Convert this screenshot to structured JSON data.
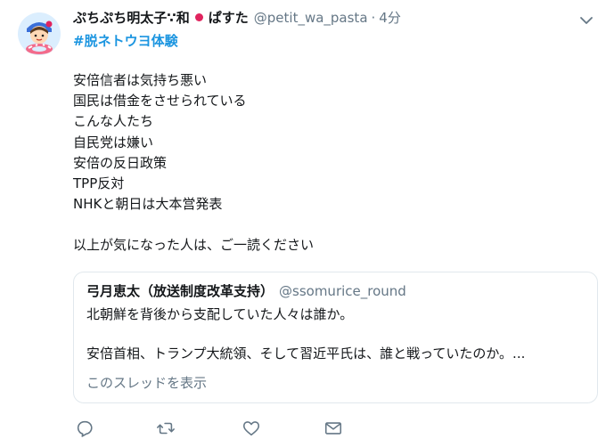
{
  "author": {
    "display_name_part1": "ぷちぷち明太子∵和",
    "display_name_part2": "ぱすた",
    "handle": "@petit_wa_pasta",
    "separator": "·",
    "time": "4分"
  },
  "hashtag": "#脱ネトウヨ体験",
  "tweet_lines": [
    "安倍信者は気持ち悪い",
    "国民は借金をさせられている",
    "こんな人たち",
    "自民党は嫌い",
    "安倍の反日政策",
    "TPP反対",
    "NHKと朝日は大本営発表",
    "",
    "以上が気になった人は、ご一読ください"
  ],
  "quoted": {
    "name": "弓月恵太（放送制度改革支持）",
    "handle": "@ssomurice_round",
    "line1": "北朝鮮を背後から支配していた人々は誰か。",
    "line2": "安倍首相、トランプ大統領、そして習近平氏は、誰と戦っていたのか。...",
    "thread_link": "このスレッドを表示"
  },
  "icons": {
    "caret": "chevron-down-icon",
    "reply": "reply-icon",
    "retweet": "retweet-icon",
    "like": "heart-icon",
    "dm": "envelope-icon"
  },
  "colors": {
    "link": "#1b95e0",
    "muted": "#657786",
    "text": "#14171a",
    "border": "#e1e8ed"
  }
}
